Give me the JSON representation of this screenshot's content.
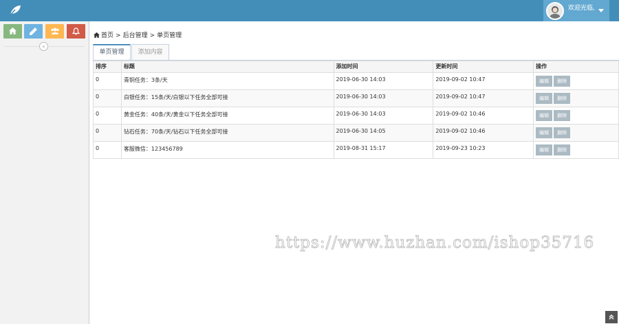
{
  "header": {
    "logo_icon": "leaf-icon",
    "user": {
      "welcome": "欢迎光临,",
      "avatar_icon": "avatar-icon"
    }
  },
  "sidebar": {
    "shortcuts": [
      {
        "icon": "home-icon",
        "color": "#87b87f"
      },
      {
        "icon": "pencil-icon",
        "color": "#6fb3e0"
      },
      {
        "icon": "users-icon",
        "color": "#ffb752"
      },
      {
        "icon": "bell-icon",
        "color": "#d15b47"
      }
    ],
    "collapse_label": "«"
  },
  "breadcrumb": {
    "home": "首页",
    "section": "后台管理",
    "page": "单页管理",
    "sep": ">"
  },
  "tabs": [
    {
      "label": "单页管理",
      "active": true
    },
    {
      "label": "添加内容",
      "active": false
    }
  ],
  "table": {
    "columns": [
      "排序",
      "标题",
      "添加时间",
      "更新时间",
      "操作"
    ],
    "rows": [
      {
        "sort": "0",
        "title": "青铜任务：3条/天",
        "added": "2019-06-30 14:03",
        "updated": "2019-09-02 10:47"
      },
      {
        "sort": "0",
        "title": "白银任务：15条/天/白银以下任务全部可接",
        "added": "2019-06-30 14:03",
        "updated": "2019-09-02 10:47"
      },
      {
        "sort": "0",
        "title": "黄金任务：40条/天/黄金以下任务全部可接",
        "added": "2019-06-30 14:03",
        "updated": "2019-09-02 10:46"
      },
      {
        "sort": "0",
        "title": "钻石任务：70条/天/钻石以下任务全部可接",
        "added": "2019-06-30 14:05",
        "updated": "2019-09-02 10:46"
      },
      {
        "sort": "0",
        "title": "客服微信：123456789",
        "added": "2019-08-31 15:17",
        "updated": "2019-09-23 10:23"
      }
    ],
    "edit_label": "编辑",
    "delete_label": "删除"
  },
  "watermark": "https://www.huzhan.com/ishop35716",
  "back_to_top": "«",
  "colors": {
    "header": "#438eb9",
    "user_box": "#62a8d1",
    "tab_accent": "#4c8fbd",
    "op_button": "#abbac3"
  }
}
